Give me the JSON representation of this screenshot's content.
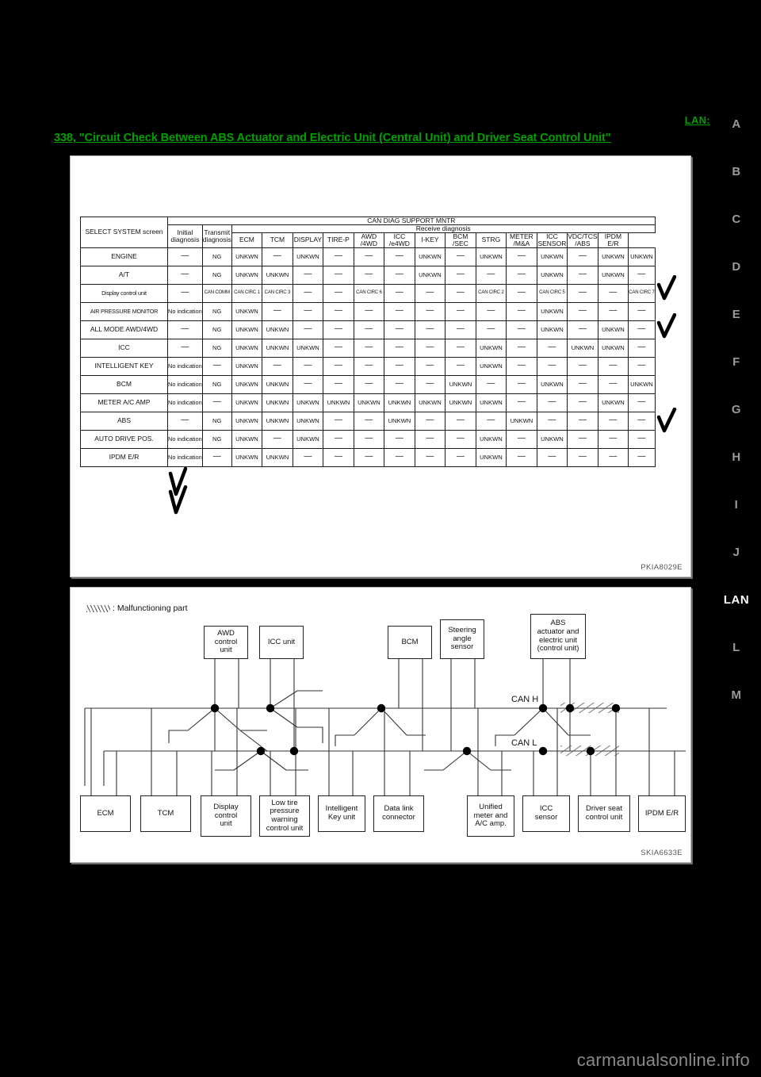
{
  "page": {
    "title_reference": "338, \"Circuit Check Between ABS Actuator and Electric Unit (Central Unit) and Driver Seat Control Unit\"",
    "section_tab": "LAN:",
    "watermark": "carmanualsonline.info"
  },
  "tabs": [
    {
      "label": "A",
      "current": false
    },
    {
      "label": "B",
      "current": false
    },
    {
      "label": "C",
      "current": false
    },
    {
      "label": "D",
      "current": false
    },
    {
      "label": "E",
      "current": false
    },
    {
      "label": "F",
      "current": false
    },
    {
      "label": "G",
      "current": false
    },
    {
      "label": "H",
      "current": false
    },
    {
      "label": "I",
      "current": false
    },
    {
      "label": "J",
      "current": false
    },
    {
      "label": "LAN",
      "current": true
    },
    {
      "label": "L",
      "current": false
    },
    {
      "label": "M",
      "current": false
    }
  ],
  "table_figure": {
    "figure_id": "PKIA8029E",
    "header": {
      "select_system": "SELECT SYSTEM screen",
      "can_diag_support_mntr": "CAN DIAG SUPPORT MNTR",
      "initial_diagnosis": [
        "Initial",
        "diagnosis"
      ],
      "transmit_diagnosis": [
        "Transmit",
        "diagnosis"
      ],
      "receive_diagnosis": "Receive diagnosis",
      "receive_columns": [
        [
          "ECM",
          ""
        ],
        [
          "TCM",
          ""
        ],
        [
          "DISPLAY",
          ""
        ],
        [
          "TIRE-P",
          ""
        ],
        [
          "AWD",
          "/4WD"
        ],
        [
          "ICC",
          "/e4WD"
        ],
        [
          "I-KEY",
          ""
        ],
        [
          "BCM",
          "/SEC"
        ],
        [
          "STRG",
          ""
        ],
        [
          "METER",
          "/M&A"
        ],
        [
          "ICC",
          "SENSOR"
        ],
        [
          "VDC/TCS",
          "/ABS"
        ],
        [
          "IPDM",
          "E/R"
        ]
      ]
    },
    "rows": [
      {
        "system": "ENGINE",
        "initial": "—",
        "transmit": "NG",
        "receive": [
          "UNKWN",
          "—",
          "UNKWN",
          "—",
          "—",
          "—",
          "UNKWN",
          "—",
          "UNKWN",
          "—",
          "UNKWN",
          "—",
          "UNKWN",
          "UNKWN"
        ]
      },
      {
        "system": "A/T",
        "initial": "—",
        "transmit": "NG",
        "receive": [
          "UNKWN",
          "UNKWN",
          "—",
          "—",
          "—",
          "—",
          "UNKWN",
          "—",
          "—",
          "—",
          "UNKWN",
          "—",
          "UNKWN",
          "—"
        ]
      },
      {
        "system": "Display control unit",
        "initial": "—",
        "transmit": "CAN COMM",
        "receive": [
          "CAN CIRC 1",
          "CAN CIRC 3",
          "—",
          "—",
          "CAN CIRC 6",
          "—",
          "—",
          "—",
          "CAN CIRC 2",
          "—",
          "CAN CIRC 5",
          "—",
          "—",
          "CAN CIRC 7"
        ]
      },
      {
        "system": "AIR PRESSURE MONITOR",
        "initial": "No indication",
        "transmit": "NG",
        "receive": [
          "UNKWN",
          "—",
          "—",
          "—",
          "—",
          "—",
          "—",
          "—",
          "—",
          "—",
          "UNKWN",
          "—",
          "—",
          "—"
        ]
      },
      {
        "system": "ALL MODE AWD/4WD",
        "initial": "—",
        "transmit": "NG",
        "receive": [
          "UNKWN",
          "UNKWN",
          "—",
          "—",
          "—",
          "—",
          "—",
          "—",
          "—",
          "—",
          "UNKWN",
          "—",
          "UNKWN",
          "—"
        ]
      },
      {
        "system": "ICC",
        "initial": "—",
        "transmit": "NG",
        "receive": [
          "UNKWN",
          "UNKWN",
          "UNKWN",
          "—",
          "—",
          "—",
          "—",
          "—",
          "UNKWN",
          "—",
          "—",
          "UNKWN",
          "UNKWN",
          "—"
        ]
      },
      {
        "system": "INTELLIGENT KEY",
        "initial": "No indication",
        "transmit": "—",
        "receive": [
          "UNKWN",
          "—",
          "—",
          "—",
          "—",
          "—",
          "—",
          "—",
          "UNKWN",
          "—",
          "—",
          "—",
          "—",
          "—"
        ]
      },
      {
        "system": "BCM",
        "initial": "No indication",
        "transmit": "NG",
        "receive": [
          "UNKWN",
          "UNKWN",
          "—",
          "—",
          "—",
          "—",
          "—",
          "UNKWN",
          "—",
          "—",
          "UNKWN",
          "—",
          "—",
          "UNKWN"
        ]
      },
      {
        "system": "METER A/C AMP",
        "initial": "No indication",
        "transmit": "—",
        "receive": [
          "UNKWN",
          "UNKWN",
          "UNKWN",
          "UNKWN",
          "UNKWN",
          "UNKWN",
          "UNKWN",
          "UNKWN",
          "UNKWN",
          "—",
          "—",
          "—",
          "UNKWN",
          "—"
        ]
      },
      {
        "system": "ABS",
        "initial": "—",
        "transmit": "NG",
        "receive": [
          "UNKWN",
          "UNKWN",
          "UNKWN",
          "—",
          "—",
          "UNKWN",
          "—",
          "—",
          "—",
          "UNKWN",
          "—",
          "—",
          "—",
          "—"
        ]
      },
      {
        "system": "AUTO DRIVE POS.",
        "initial": "No indication",
        "transmit": "NG",
        "receive": [
          "UNKWN",
          "—",
          "UNKWN",
          "—",
          "—",
          "—",
          "—",
          "—",
          "UNKWN",
          "—",
          "UNKWN",
          "—",
          "—",
          "—"
        ]
      },
      {
        "system": "IPDM E/R",
        "initial": "No indication",
        "transmit": "—",
        "receive": [
          "UNKWN",
          "UNKWN",
          "—",
          "—",
          "—",
          "—",
          "—",
          "—",
          "UNKWN",
          "—",
          "—",
          "—",
          "—",
          "—"
        ]
      }
    ]
  },
  "network_figure": {
    "figure_id": "SKIA6633E",
    "legend_label": ": Malfunctioning part",
    "bus_labels": {
      "can_h": "CAN H",
      "can_l": "CAN L"
    },
    "top_nodes": [
      {
        "label": "AWD control\nunit"
      },
      {
        "label": "ICC unit"
      },
      {
        "label": "BCM"
      },
      {
        "label": "Steering\nangle\nsensor"
      },
      {
        "label": "ABS\nactuator and\nelectric unit\n(control unit)"
      }
    ],
    "bottom_nodes": [
      {
        "label": "ECM"
      },
      {
        "label": "TCM"
      },
      {
        "label": "Display\ncontrol\nunit"
      },
      {
        "label": "Low tire\npressure\nwarning\ncontrol unit"
      },
      {
        "label": "Intelligent\nKey unit"
      },
      {
        "label": "Data link\nconnector"
      },
      {
        "label": "Unified\nmeter and\nA/C amp."
      },
      {
        "label": "ICC\nsensor"
      },
      {
        "label": "Driver seat\ncontrol unit"
      },
      {
        "label": "IPDM E/R"
      }
    ]
  }
}
